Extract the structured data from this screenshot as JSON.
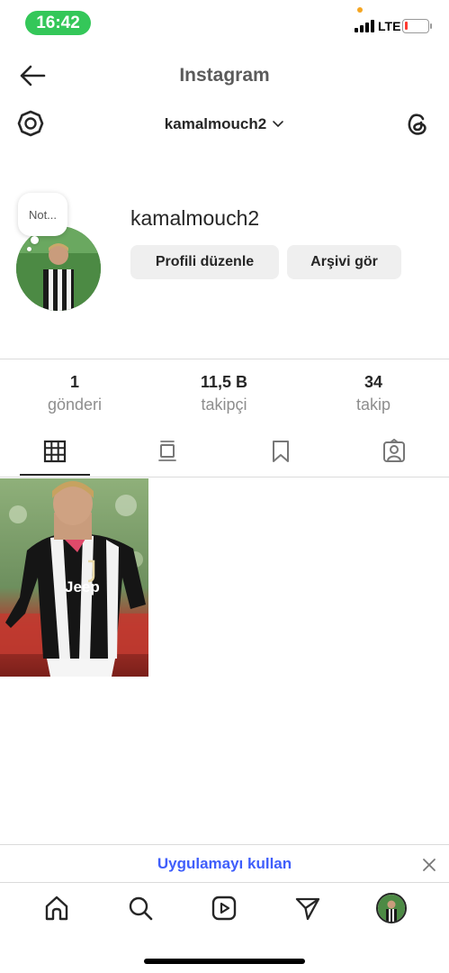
{
  "status_bar": {
    "time": "16:42",
    "network": "LTE"
  },
  "header": {
    "title": "Instagram",
    "username": "kamalmouch2"
  },
  "profile": {
    "note": "Not...",
    "name": "kamalmouch2",
    "edit_button": "Profili düzenle",
    "archive_button": "Arşivi gör"
  },
  "stats": [
    {
      "value": "1",
      "label": "gönderi"
    },
    {
      "value": "11,5 B",
      "label": "takipçi"
    },
    {
      "value": "34",
      "label": "takip"
    }
  ],
  "tabs": [
    "grid-icon",
    "feed-icon",
    "saved-icon",
    "tagged-icon"
  ],
  "banner": {
    "text": "Uygulamayı kullan"
  },
  "nav": [
    "home-icon",
    "search-icon",
    "reels-icon",
    "direct-icon",
    "profile-avatar"
  ],
  "colors": {
    "accent": "#3f5efb",
    "time_pill": "#34c759",
    "battery_low": "#ff3b30"
  }
}
